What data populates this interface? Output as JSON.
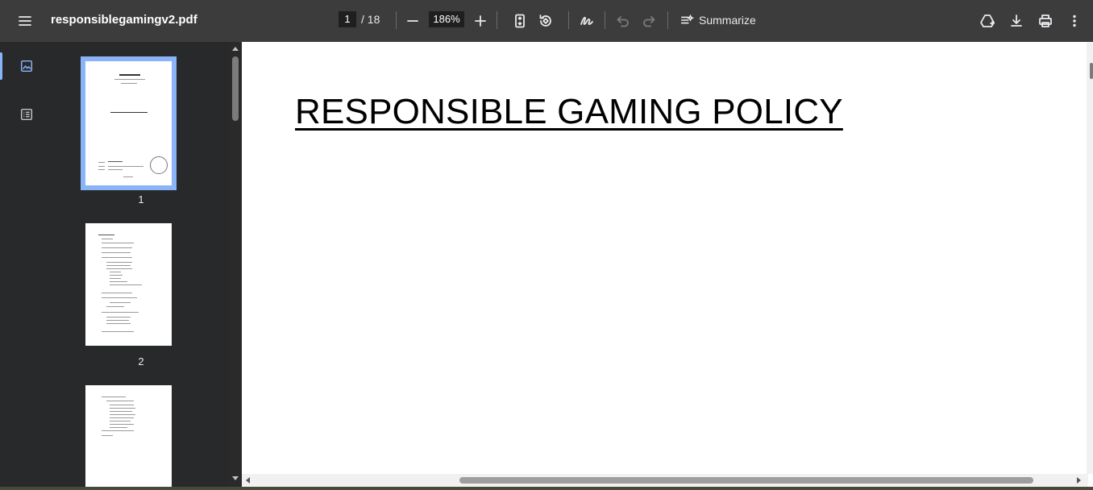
{
  "toolbar": {
    "file_name": "responsiblegamingv2.pdf",
    "current_page": "1",
    "page_total": "/ 18",
    "zoom": "186%",
    "summarize_label": "Summarize",
    "icons": [
      "menu-icon",
      "zoom-out-icon",
      "zoom-in-icon",
      "fit-page-icon",
      "rotate-icon",
      "draw-icon",
      "undo-icon",
      "redo-icon",
      "summarize-icon",
      "drive-icon",
      "download-icon",
      "print-icon",
      "more-icon"
    ]
  },
  "sidebar": {
    "rail_items": [
      {
        "name": "thumbnails",
        "icon": "image-icon",
        "active": true
      },
      {
        "name": "outline",
        "icon": "list-icon",
        "active": false
      }
    ],
    "thumbnails": [
      {
        "page": "1",
        "selected": true
      },
      {
        "page": "2",
        "selected": false
      },
      {
        "page": "",
        "selected": false
      }
    ]
  },
  "document": {
    "heading": "RESPONSIBLE GAMING POLICY"
  },
  "colors": {
    "toolbar_bg": "#3c3c3c",
    "panel_bg": "#28292a",
    "accent": "#8ab4f8"
  }
}
